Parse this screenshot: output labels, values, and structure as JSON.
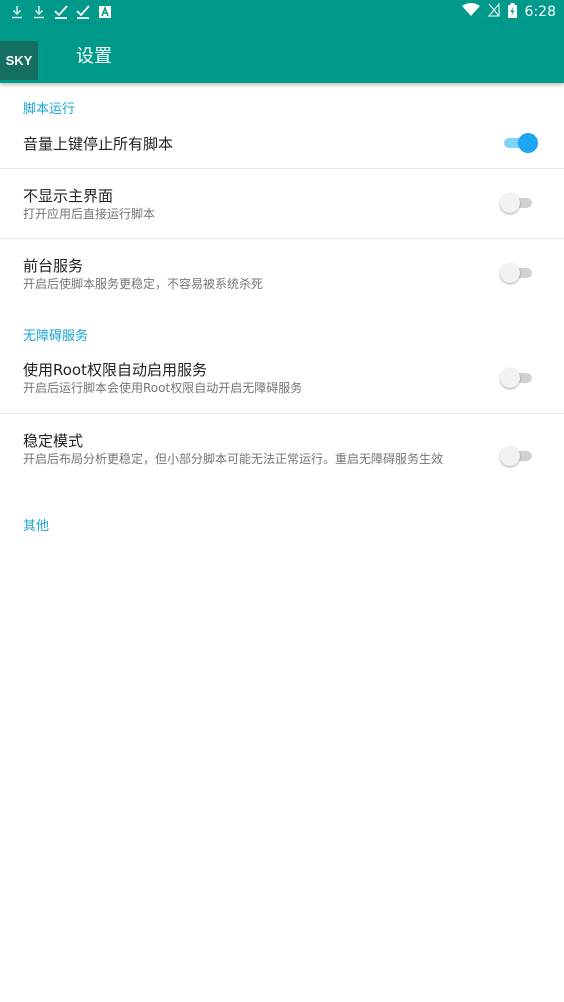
{
  "status_bar": {
    "time": "6:28",
    "icons_left": [
      "download-icon",
      "download-icon",
      "check-icon",
      "check-icon",
      "a-badge-icon"
    ],
    "icons_right": [
      "wifi-icon",
      "no-sim-icon",
      "battery-charging-icon"
    ]
  },
  "app_bar": {
    "badge": "SKY",
    "title": "设置"
  },
  "sections": {
    "script_run": "脚本运行",
    "accessibility": "无障碍服务",
    "other": "其他"
  },
  "settings": {
    "volume_stop": {
      "title": "音量上键停止所有脚本",
      "enabled": true
    },
    "hide_main": {
      "title": "不显示主界面",
      "subtitle": "打开应用后直接运行脚本",
      "enabled": false
    },
    "foreground": {
      "title": "前台服务",
      "subtitle": "开启后使脚本服务更稳定，不容易被系统杀死",
      "enabled": false
    },
    "root_auto": {
      "title": "使用Root权限自动启用服务",
      "subtitle": "开启后运行脚本会使用Root权限自动开启无障碍服务",
      "enabled": false
    },
    "stable_mode": {
      "title": "稳定模式",
      "subtitle": "开启后布局分析更稳定，但小部分脚本可能无法正常运行。重启无障碍服务生效",
      "enabled": false
    }
  },
  "colors": {
    "primary": "#009a8b",
    "accent": "#1ea5f0",
    "section_header": "#16a3d6"
  }
}
